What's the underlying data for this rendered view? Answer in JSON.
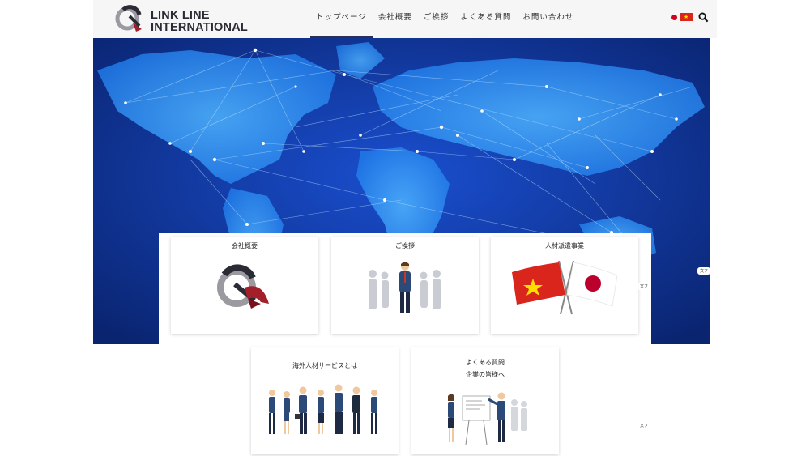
{
  "header": {
    "logo_line1": "LINK LINE",
    "logo_line2": "INTERNATIONAL",
    "nav": [
      "トップページ",
      "会社概要",
      "ご挨拶",
      "よくある質問",
      "お問い合わせ"
    ]
  },
  "language": {
    "jp_icon": "japan-flag-dot",
    "vn_icon": "vietnam-flag",
    "vn_star": "★"
  },
  "search_icon": "magnifier",
  "cards": {
    "company": {
      "title": "会社概要"
    },
    "greeting": {
      "title": "ご挨拶"
    },
    "dispatch": {
      "title": "人材派遣事業"
    },
    "overseas": {
      "title": "海外人材サービスとは"
    },
    "faq": {
      "title": "よくある質問",
      "subtitle": "企業の皆様へ"
    }
  },
  "side_labels": [
    "文フ",
    "文フ",
    "文フ"
  ],
  "colors": {
    "accent": "#2a2f5a",
    "brand_red": "#a3202a",
    "hero_bg": "#0b2a86"
  }
}
